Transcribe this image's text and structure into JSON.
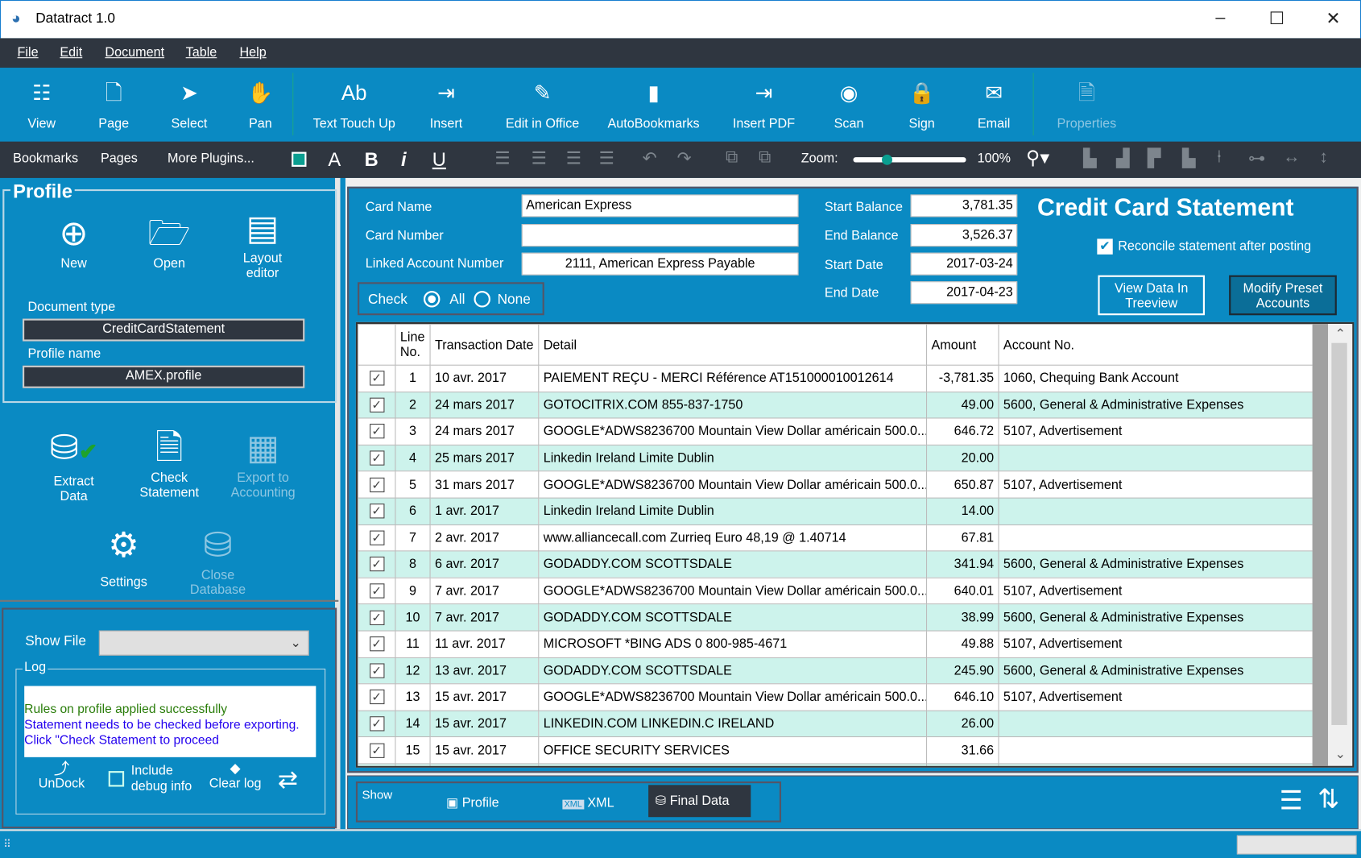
{
  "window": {
    "title": "Datatract 1.0",
    "minimize": "–",
    "maximize": "☐",
    "close": "✕"
  },
  "menu": [
    "File",
    "Edit",
    "Document",
    "Table",
    "Help"
  ],
  "ribbon": [
    {
      "label": "View",
      "icon": "view-grid-icon",
      "glyph": "☷"
    },
    {
      "label": "Page",
      "icon": "page-icon",
      "glyph": "🗋"
    },
    {
      "label": "Select",
      "icon": "cursor-icon",
      "glyph": "➤"
    },
    {
      "label": "Pan",
      "icon": "hand-icon",
      "glyph": "✋"
    },
    {
      "label": "Text Touch Up",
      "icon": "text-touchup-icon",
      "glyph": "Ab"
    },
    {
      "label": "Insert",
      "icon": "insert-pdf-icon",
      "glyph": "⇥"
    },
    {
      "label": "Edit in Office",
      "icon": "edit-icon",
      "glyph": "✎"
    },
    {
      "label": "AutoBookmarks",
      "icon": "bookmark-icon",
      "glyph": "▮"
    },
    {
      "label": "Insert PDF",
      "icon": "insert-pdf-icon",
      "glyph": "⇥"
    },
    {
      "label": "Scan",
      "icon": "eye-icon",
      "glyph": "◉"
    },
    {
      "label": "Sign",
      "icon": "lock-icon",
      "glyph": "🔒"
    },
    {
      "label": "Email",
      "icon": "email-icon",
      "glyph": "✉"
    },
    {
      "label": "Properties",
      "icon": "properties-icon",
      "glyph": "🗎"
    }
  ],
  "toolbar": {
    "bookmarks": "Bookmarks",
    "pages": "Pages",
    "more_plugins": "More Plugins...",
    "zoom_label": "Zoom:",
    "zoom_value": "100%",
    "zoom_slider_fraction": 0.3
  },
  "profile": {
    "title": "Profile",
    "new": "New",
    "open": "Open",
    "layout_editor": "Layout editor",
    "doc_type_label": "Document type",
    "doc_type": "CreditCardStatement",
    "profile_name_label": "Profile name",
    "profile_name": "AMEX.profile"
  },
  "actions": {
    "extract": "Extract Data",
    "check": "Check Statement",
    "export": "Export to Accounting",
    "settings": "Settings",
    "close_db": "Close Database"
  },
  "log": {
    "show_file_label": "Show File",
    "show_file_value": "",
    "title": "Log",
    "line_success": "Rules on profile applied successfully",
    "line_info": "Statement needs to be checked before exporting. Click \"Check Statement to proceed",
    "undock": "UnDock",
    "include_debug": "Include debug info",
    "clear_log": "Clear log",
    "colors": {
      "success": "#2a7d0a",
      "info": "#2200ee"
    }
  },
  "form": {
    "card_name_label": "Card Name",
    "card_name": "American Express",
    "card_number_label": "Card Number",
    "card_number": "",
    "linked_label": "Linked Account Number",
    "linked": "2111, American Express Payable",
    "start_balance_label": "Start Balance",
    "start_balance": "3,781.35",
    "end_balance_label": "End Balance",
    "end_balance": "3,526.37",
    "start_date_label": "Start Date",
    "start_date": "2017-03-24",
    "end_date_label": "End Date",
    "end_date": "2017-04-23",
    "heading": "Credit Card Statement",
    "reconcile": "Reconcile statement after posting",
    "check_label": "Check",
    "all": "All",
    "none": "None",
    "view_tree": "View Data In Treeview",
    "modify_preset": "Modify Preset Accounts"
  },
  "table": {
    "headers": [
      "",
      "Line No.",
      "Transaction Date",
      "Detail",
      "Amount",
      "Account No."
    ],
    "rows": [
      [
        "1",
        "10 avr. 2017",
        "PAIEMENT REÇU - MERCI Référence AT151000010012614",
        "-3,781.35",
        "1060, Chequing Bank Account"
      ],
      [
        "2",
        "24 mars 2017",
        "GOTOCITRIX.COM 855-837-1750",
        "49.00",
        "5600, General & Administrative Expenses"
      ],
      [
        "3",
        "24 mars 2017",
        "GOOGLE*ADWS8236700 Mountain View Dollar américain 500.0...",
        "646.72",
        "5107, Advertisement"
      ],
      [
        "4",
        "25 mars 2017",
        "Linkedin Ireland Limite Dublin",
        "20.00",
        ""
      ],
      [
        "5",
        "31 mars 2017",
        "GOOGLE*ADWS8236700 Mountain View Dollar américain 500.0...",
        "650.87",
        "5107, Advertisement"
      ],
      [
        "6",
        "1 avr. 2017",
        "Linkedin Ireland Limite Dublin",
        "14.00",
        ""
      ],
      [
        "7",
        "2 avr. 2017",
        "www.alliancecall.com Zurrieq Euro 48,19 @ 1.40714",
        "67.81",
        ""
      ],
      [
        "8",
        "6 avr. 2017",
        "GODADDY.COM SCOTTSDALE",
        "341.94",
        "5600, General & Administrative Expenses"
      ],
      [
        "9",
        "7 avr. 2017",
        "GOOGLE*ADWS8236700 Mountain View Dollar américain 500.0...",
        "640.01",
        "5107, Advertisement"
      ],
      [
        "10",
        "7 avr. 2017",
        "GODADDY.COM SCOTTSDALE",
        "38.99",
        "5600, General & Administrative Expenses"
      ],
      [
        "11",
        "11 avr. 2017",
        "MICROSOFT *BING ADS 0 800-985-4671",
        "49.88",
        "5107, Advertisement"
      ],
      [
        "12",
        "13 avr. 2017",
        "GODADDY.COM SCOTTSDALE",
        "245.90",
        "5600, General & Administrative Expenses"
      ],
      [
        "13",
        "15 avr. 2017",
        "GOOGLE*ADWS8236700 Mountain View Dollar américain 500.0...",
        "646.10",
        "5107, Advertisement"
      ],
      [
        "14",
        "15 avr. 2017",
        "LINKEDIN.COM LINKEDIN.C IRELAND",
        "26.00",
        ""
      ],
      [
        "15",
        "15 avr. 2017",
        "OFFICE SECURITY SERVICES",
        "31.66",
        ""
      ]
    ]
  },
  "bottom": {
    "show": "Show",
    "profile": "Profile",
    "xml": "XML",
    "final_data": "Final Data",
    "selected": "Final Data"
  },
  "colors": {
    "accent": "#0a8ac3",
    "dark": "#2f3640",
    "row_alt": "#cdf3ec"
  }
}
